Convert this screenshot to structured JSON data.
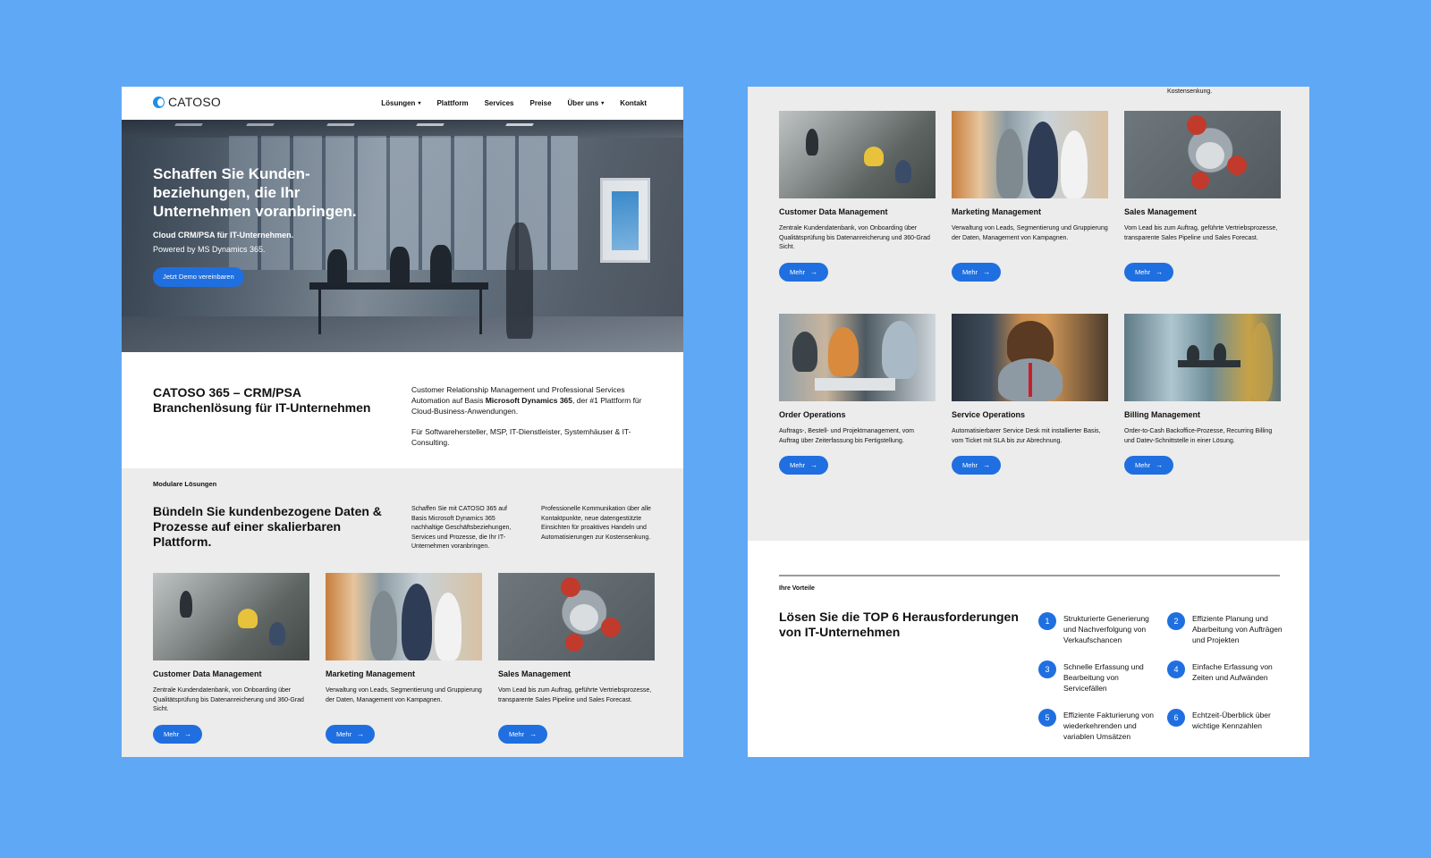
{
  "left": {
    "logo": "CATOSO",
    "nav": [
      {
        "label": "Lösungen",
        "caret": true
      },
      {
        "label": "Plattform",
        "caret": false
      },
      {
        "label": "Services",
        "caret": false
      },
      {
        "label": "Preise",
        "caret": false
      },
      {
        "label": "Über uns",
        "caret": true
      },
      {
        "label": "Kontakt",
        "caret": false
      }
    ],
    "hero": {
      "title": "Schaffen Sie Kunden-beziehungen, die Ihr Unternehmen voranbringen.",
      "subtitle": "Cloud CRM/PSA für IT-Unternehmen.",
      "subtitle2": "Powered by MS Dynamics 365.",
      "cta": "Jetzt Demo vereinbaren"
    },
    "intro": {
      "title": "CATOSO 365 – CRM/PSA Branchenlösung für IT-Unternehmen",
      "p1_before": "Customer Relationship Management und Professional Services Automation auf Basis ",
      "p1_bold": "Microsoft Dynamics 365",
      "p1_after": ", der #1 Plattform für Cloud-Business-Anwendungen.",
      "p2": "Für Softwarehersteller, MSP, IT-Dienstleister, Systemhäuser & IT-Consulting."
    },
    "modular": {
      "kicker": "Modulare Lösungen",
      "title": "Bündeln Sie kundenbezogene Daten & Prozesse auf einer skalierbaren Plattform.",
      "p1": "Schaffen Sie mit CATOSO 365 auf Basis Microsoft Dynamics 365 nachhaltige Geschäftsbeziehungen, Services und Prozesse, die Ihr IT-Unternehmen voranbringen.",
      "p2": "Professionelle Kommunikation über alle Kontaktpunkte, neue datengestützte Einsichten für proaktives Handeln und Automatisierungen zur Kostensenkung."
    }
  },
  "cards": [
    {
      "title": "Customer Data Management",
      "desc": "Zentrale Kundendatenbank, von Onboarding über Qualitätsprüfung bis Datenanreicherung und 360-Grad Sicht.",
      "button": "Mehr"
    },
    {
      "title": "Marketing Management",
      "desc": "Verwaltung von Leads, Segmentierung und Gruppierung der Daten, Management von Kampagnen.",
      "button": "Mehr"
    },
    {
      "title": "Sales Management",
      "desc": "Vom Lead bis zum Auftrag, geführte Vertriebsprozesse, transparente Sales Pipeline und Sales Forecast.",
      "button": "Mehr"
    },
    {
      "title": "Order Operations",
      "desc": "Auftrags-, Bestell- und Projektmanagement, vom Auftrag über Zeiterfassung bis Fertigstellung.",
      "button": "Mehr"
    },
    {
      "title": "Service Operations",
      "desc": "Automatisierbarer Service Desk mit installierter Basis, vom Ticket mit SLA bis zur Abrechnung.",
      "button": "Mehr"
    },
    {
      "title": "Billing Management",
      "desc": "Order-to-Cash Backoffice-Prozesse, Recurring Billing und Datev-Schnittstelle in einer Lösung.",
      "button": "Mehr"
    }
  ],
  "right": {
    "fragment": "Kostensenkung.",
    "kicker": "Ihre Vorteile",
    "title": "Lösen Sie die TOP 6 Herausforderungen von IT-Unternehmen",
    "benefits": [
      {
        "num": "1",
        "text": "Strukturierte Generierung und Nachverfolgung von Verkaufschancen"
      },
      {
        "num": "2",
        "text": "Effiziente Planung und Abarbeitung von Aufträgen und Projekten"
      },
      {
        "num": "3",
        "text": "Schnelle Erfassung und Bearbeitung von Servicefällen"
      },
      {
        "num": "4",
        "text": "Einfache Erfassung von Zeiten und Aufwänden"
      },
      {
        "num": "5",
        "text": "Effiziente Fakturierung von wiederkehrenden und variablen Umsätzen"
      },
      {
        "num": "6",
        "text": "Echtzeit-Überblick über wichtige Kennzahlen"
      }
    ]
  },
  "colors": {
    "background": "#5fa8f5",
    "accent": "#1f6fe0",
    "section_gray": "#ececec"
  }
}
